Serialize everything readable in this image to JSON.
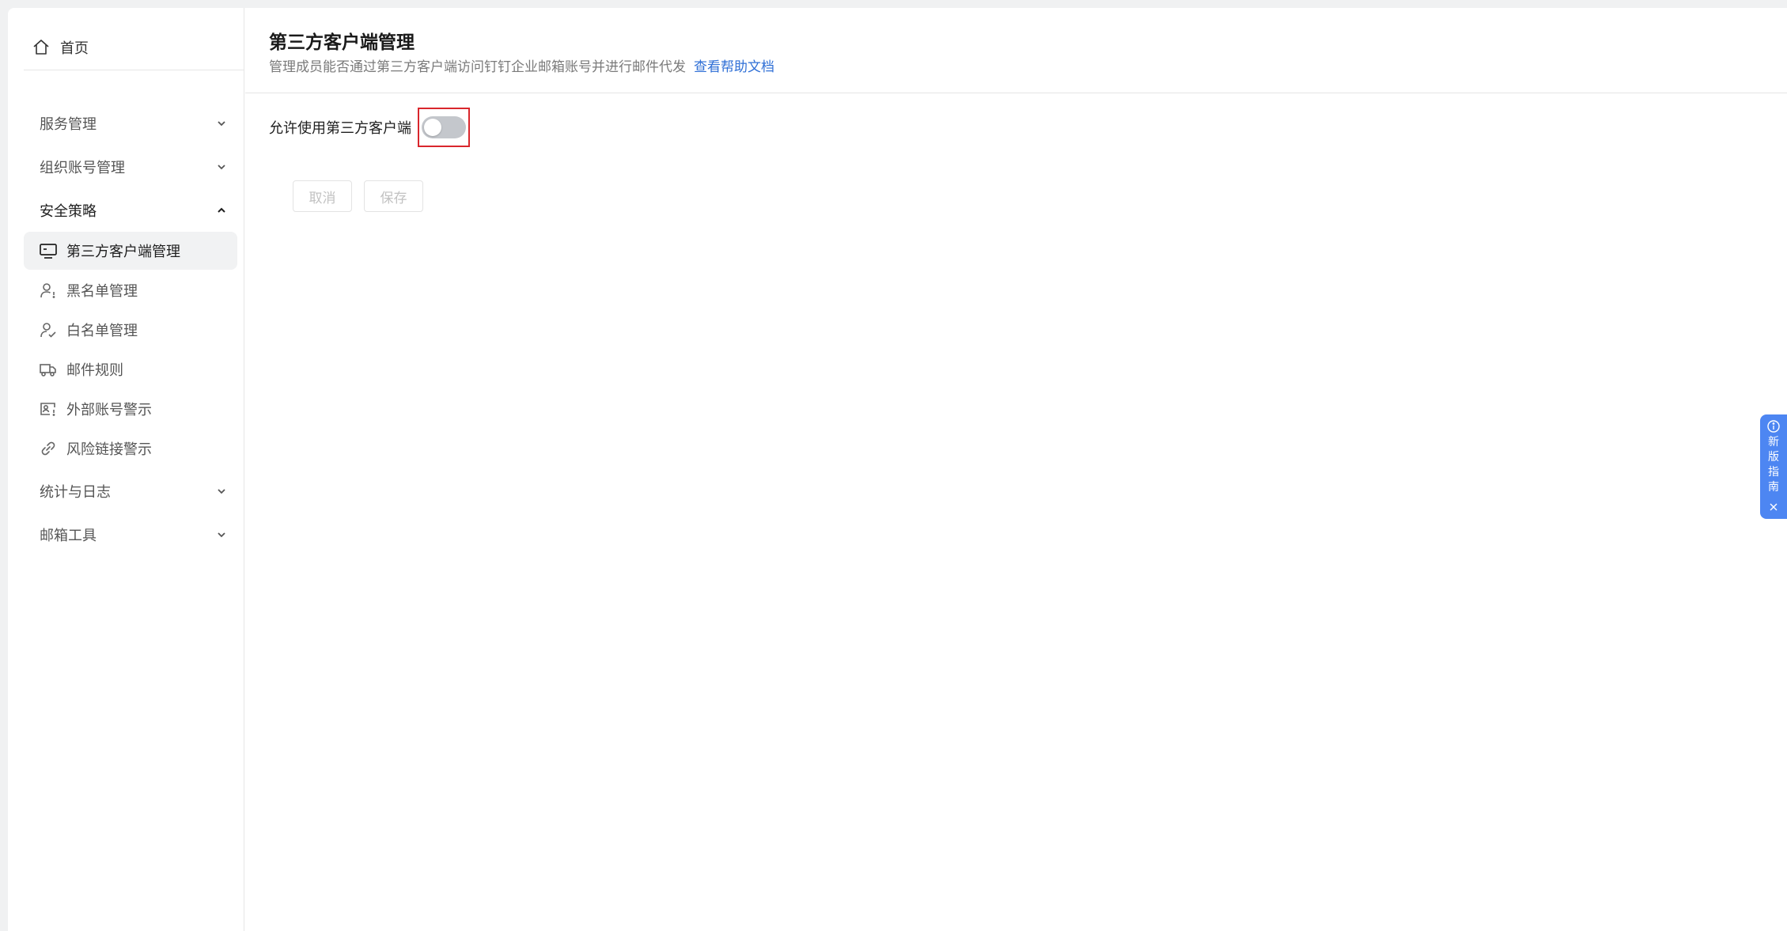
{
  "sidebar": {
    "home": {
      "label": "首页",
      "icon": "home-icon"
    },
    "groups": [
      {
        "label": "服务管理",
        "expanded": false
      },
      {
        "label": "组织账号管理",
        "expanded": false
      },
      {
        "label": "安全策略",
        "expanded": true
      },
      {
        "label": "统计与日志",
        "expanded": false
      },
      {
        "label": "邮箱工具",
        "expanded": false
      }
    ],
    "security_items": [
      {
        "label": "第三方客户端管理",
        "icon": "monitor-icon",
        "active": true
      },
      {
        "label": "黑名单管理",
        "icon": "user-block-icon",
        "active": false
      },
      {
        "label": "白名单管理",
        "icon": "user-check-icon",
        "active": false
      },
      {
        "label": "邮件规则",
        "icon": "truck-icon",
        "active": false
      },
      {
        "label": "外部账号警示",
        "icon": "id-card-warning-icon",
        "active": false
      },
      {
        "label": "风险链接警示",
        "icon": "link-icon",
        "active": false
      }
    ]
  },
  "header": {
    "title": "第三方客户端管理",
    "description": "管理成员能否通过第三方客户端访问钉钉企业邮箱账号并进行邮件代发",
    "help_link": "查看帮助文档"
  },
  "settings": {
    "allow_third_party_label": "允许使用第三方客户端",
    "allow_third_party_enabled": false
  },
  "actions": {
    "cancel": "取消",
    "save": "保存"
  },
  "guide": {
    "chars": [
      "新",
      "版",
      "指",
      "南"
    ]
  },
  "colors": {
    "accent": "#2f6fd6",
    "guide_bg": "#4d86f2",
    "highlight_border": "#d9262c",
    "toggle_off": "#c4c7cc"
  }
}
